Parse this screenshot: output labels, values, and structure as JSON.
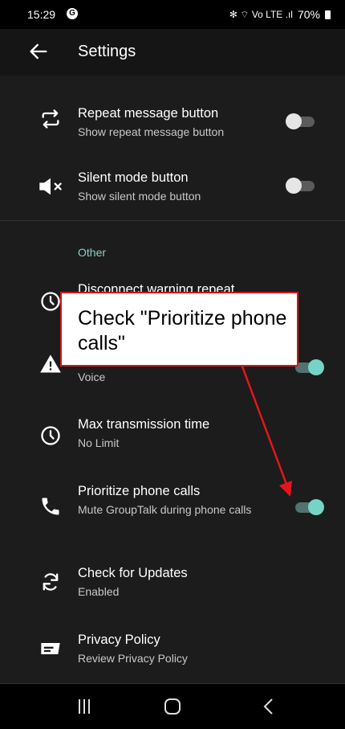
{
  "status_bar": {
    "time": "15:29",
    "app_badge": "G",
    "indicators": "✻ ⌔ Vo LTE .ıl",
    "battery": "70%"
  },
  "header": {
    "title": "Settings",
    "back_icon": "arrow-left-icon"
  },
  "items": [
    {
      "title": "Repeat message button",
      "summary": "Show repeat message button",
      "icon": "repeat-icon",
      "toggle": false
    },
    {
      "title": "Silent mode button",
      "summary": "Show silent mode button",
      "icon": "speaker-mute-icon",
      "toggle": false
    },
    {
      "title": "Disconnect warning repeat",
      "summary": "",
      "icon": "clock-icon"
    },
    {
      "title": "",
      "summary": "Voice",
      "icon": "warning-icon",
      "toggle": true
    },
    {
      "title": "Max transmission time",
      "summary": "No Limit",
      "icon": "clock-icon"
    },
    {
      "title": "Prioritize phone calls",
      "summary": "Mute GroupTalk during phone calls",
      "icon": "phone-icon",
      "toggle": true
    },
    {
      "title": "Check for Updates",
      "summary": "Enabled",
      "icon": "sync-icon"
    },
    {
      "title": "Privacy Policy",
      "summary": "Review Privacy Policy",
      "icon": "document-icon"
    }
  ],
  "section": {
    "other": "Other"
  },
  "callout": {
    "text": "Check \"Prioritize phone calls\""
  },
  "colors": {
    "accent": "#76d4c7",
    "section": "#8fcec6",
    "callout_border": "#d6171b",
    "arrow": "#e3161e"
  }
}
